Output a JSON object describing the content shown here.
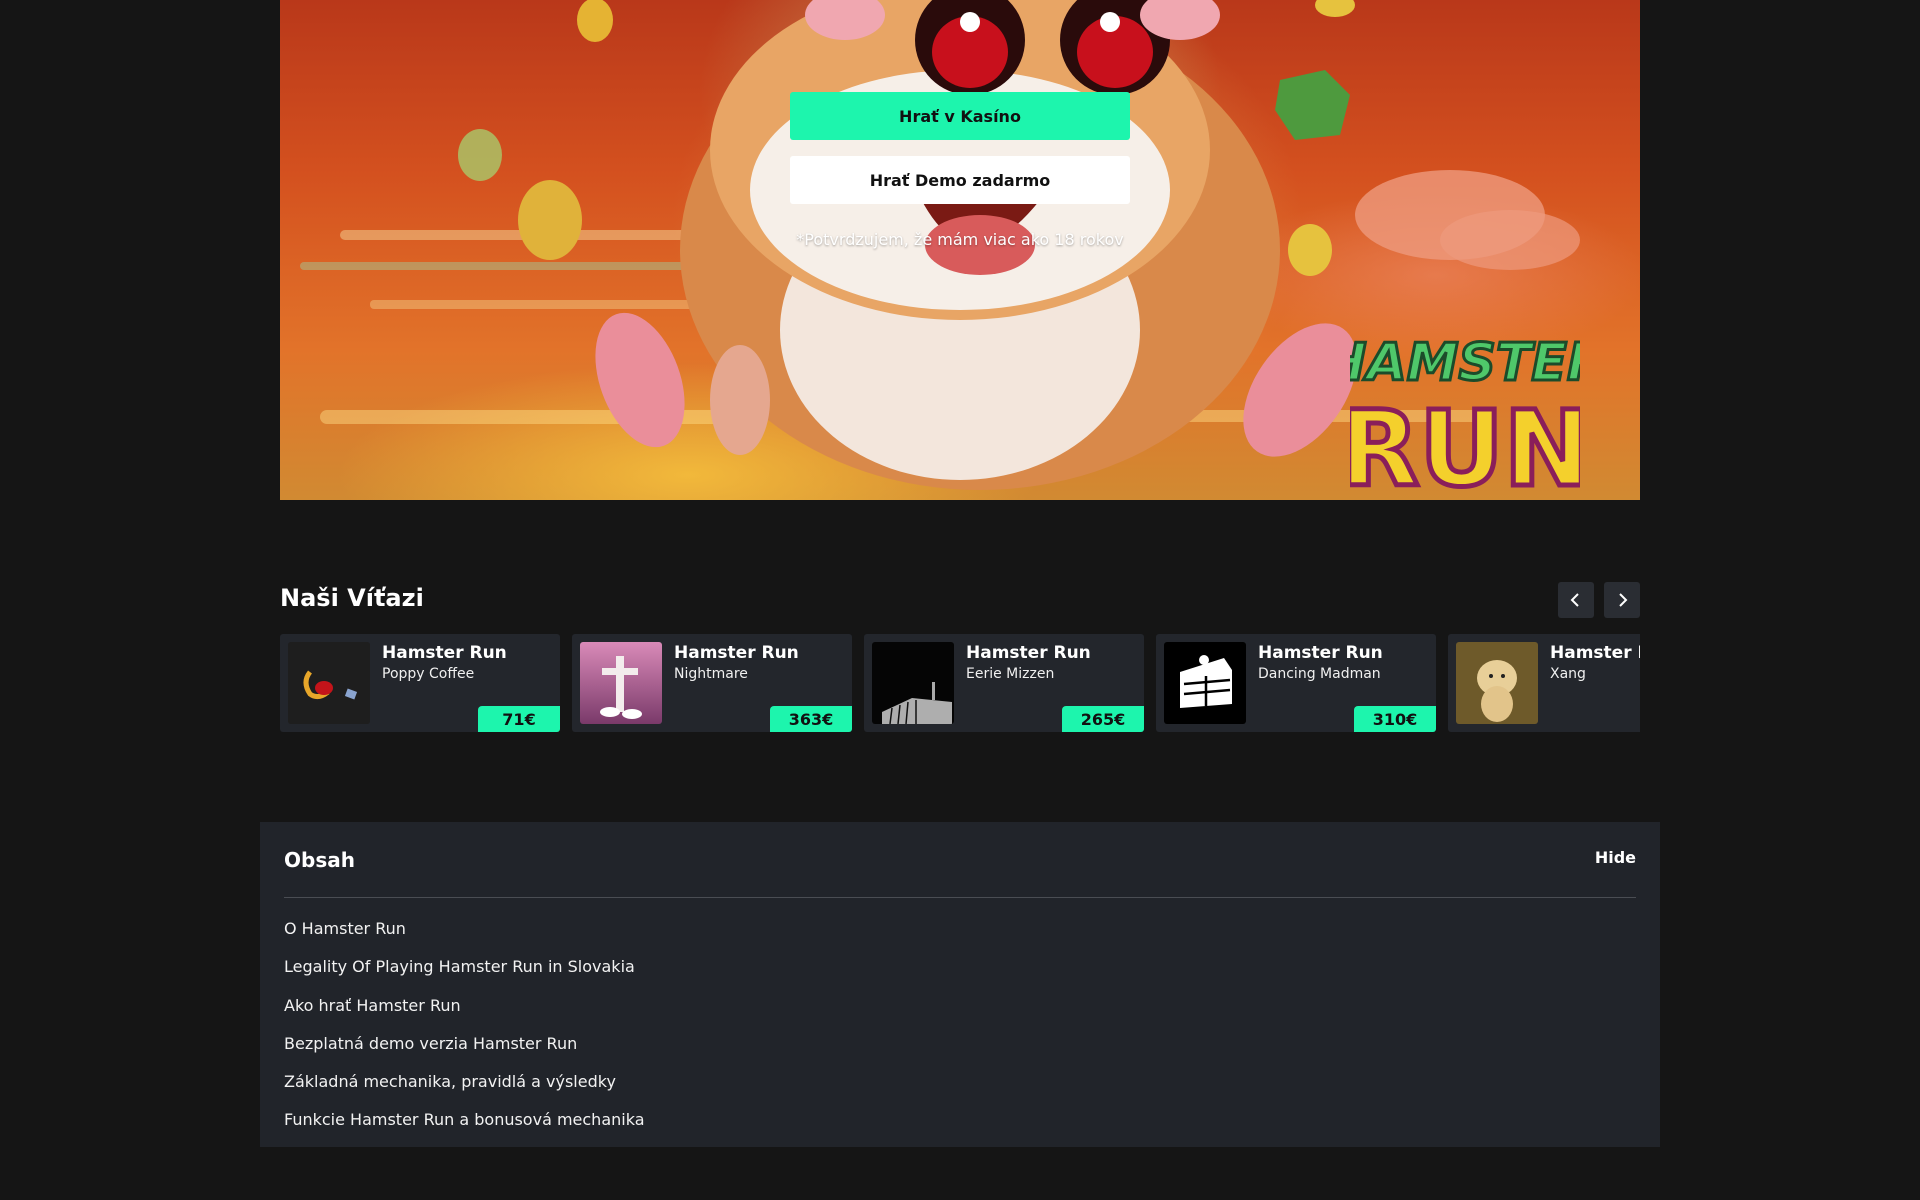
{
  "hero": {
    "casino_button": "Hrať v Kasíno",
    "demo_button": "Hrať Demo zadarmo",
    "age_note": "*Potvrdzujem, že mám viac ako 18 rokov",
    "logo_line1": "HAMSTER",
    "logo_line2": "RUN"
  },
  "winners": {
    "title": "Naši Víťazi",
    "items": [
      {
        "game": "Hamster Run",
        "player": "Poppy Coffee",
        "amount": "71€"
      },
      {
        "game": "Hamster Run",
        "player": "Nightmare",
        "amount": "363€"
      },
      {
        "game": "Hamster Run",
        "player": "Eerie Mizzen",
        "amount": "265€"
      },
      {
        "game": "Hamster Run",
        "player": "Dancing Madman",
        "amount": "310€"
      },
      {
        "game": "Hamster Run",
        "player": "Xang",
        "amount": ""
      }
    ]
  },
  "toc": {
    "title": "Obsah",
    "hide_label": "Hide",
    "items": [
      "O Hamster Run",
      "Legality Of Playing Hamster Run in Slovakia",
      "Ako hrať Hamster Run",
      "Bezplatná demo verzia Hamster Run",
      "Základná mechanika, pravidlá a výsledky",
      "Funkcie Hamster Run a bonusová mechanika"
    ]
  },
  "colors": {
    "page_bg": "#151515",
    "accent": "#1df5ad",
    "card_bg": "#23262c",
    "toc_bg": "#21242a"
  }
}
